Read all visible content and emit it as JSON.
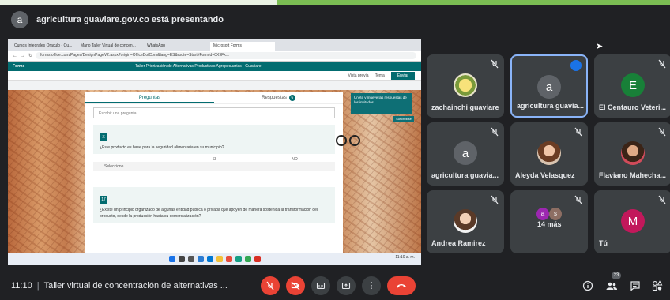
{
  "presenter": {
    "avatar_letter": "a",
    "text": "agricultura guaviare.gov.co está presentando"
  },
  "shared_screen": {
    "browser_tabs": [
      "Cursos Integrales Oraculo - Qu...",
      "Mano Taller Virtual de concen...",
      "WhatsApp",
      "Microsoft Forms"
    ],
    "address": "forms.office.com/Pages/DesignPageV2.aspx?origin=OfficeDotCom&lang=ES&route=Start#FormId=0X9Fk...",
    "forms_brand": "Forms",
    "forms_title": "Taller Priorización de Alternativas Productivas Agropecuarias - Guaviare",
    "toolbar": [
      "Vista previa",
      "Tema"
    ],
    "send_label": "Enviar",
    "tab_questions": "Preguntas",
    "tab_responses": "Respuestas",
    "responses_count": "6",
    "search_placeholder": "Escribir una pregunta",
    "q1_number": "X",
    "q1_text": "¿Este producto es base para la seguridad alimentaria en su municipio?",
    "grid_col_si": "SI",
    "grid_col_no": "NO",
    "grid_row": "Seleccione",
    "q2_number": "17",
    "q2_text": "¿Existe un principio organizado de algunas entidad pública o privada que apoyen de manera sostenida la transformación del producto, desde la producción hasta su comercialización?",
    "side_panel_text": "Únete y mueve las respuestas de los invitados",
    "side_button": "Suscribirse",
    "taskbar_time": "11:10 a. m."
  },
  "participants": [
    {
      "name": "zachainchi guaviare",
      "type": "photo-logo",
      "muted": true,
      "highlight": false
    },
    {
      "name": "agricultura guavia...",
      "type": "letter",
      "letter": "a",
      "color": "#5f6368",
      "muted": false,
      "highlight": true
    },
    {
      "name": "El Centauro Veteri...",
      "type": "letter",
      "letter": "E",
      "color": "#188038",
      "muted": true,
      "highlight": false
    },
    {
      "name": "agricultura guavia...",
      "type": "letter",
      "letter": "a",
      "color": "#5f6368",
      "muted": true,
      "highlight": false
    },
    {
      "name": "Aleyda Velasquez",
      "type": "photo-face",
      "muted": true,
      "highlight": false
    },
    {
      "name": "Flaviano Mahecha...",
      "type": "photo-face",
      "muted": true,
      "highlight": false
    },
    {
      "name": "Andrea Ramirez",
      "type": "photo-face",
      "muted": true,
      "highlight": false
    },
    {
      "name": "14 más",
      "type": "more",
      "muted": false,
      "highlight": false
    },
    {
      "name": "Tú",
      "type": "letter",
      "letter": "M",
      "color": "#c2185b",
      "muted": true,
      "highlight": false
    }
  ],
  "meeting": {
    "time": "11:10",
    "separator": "|",
    "title": "Taller virtual de concentración de alternativas ...",
    "people_count": "23"
  },
  "colors": {
    "background": "#202124",
    "tile": "#3c4043",
    "red": "#ea4335",
    "accent": "#8ab4f8",
    "forms_teal": "#036c70"
  }
}
